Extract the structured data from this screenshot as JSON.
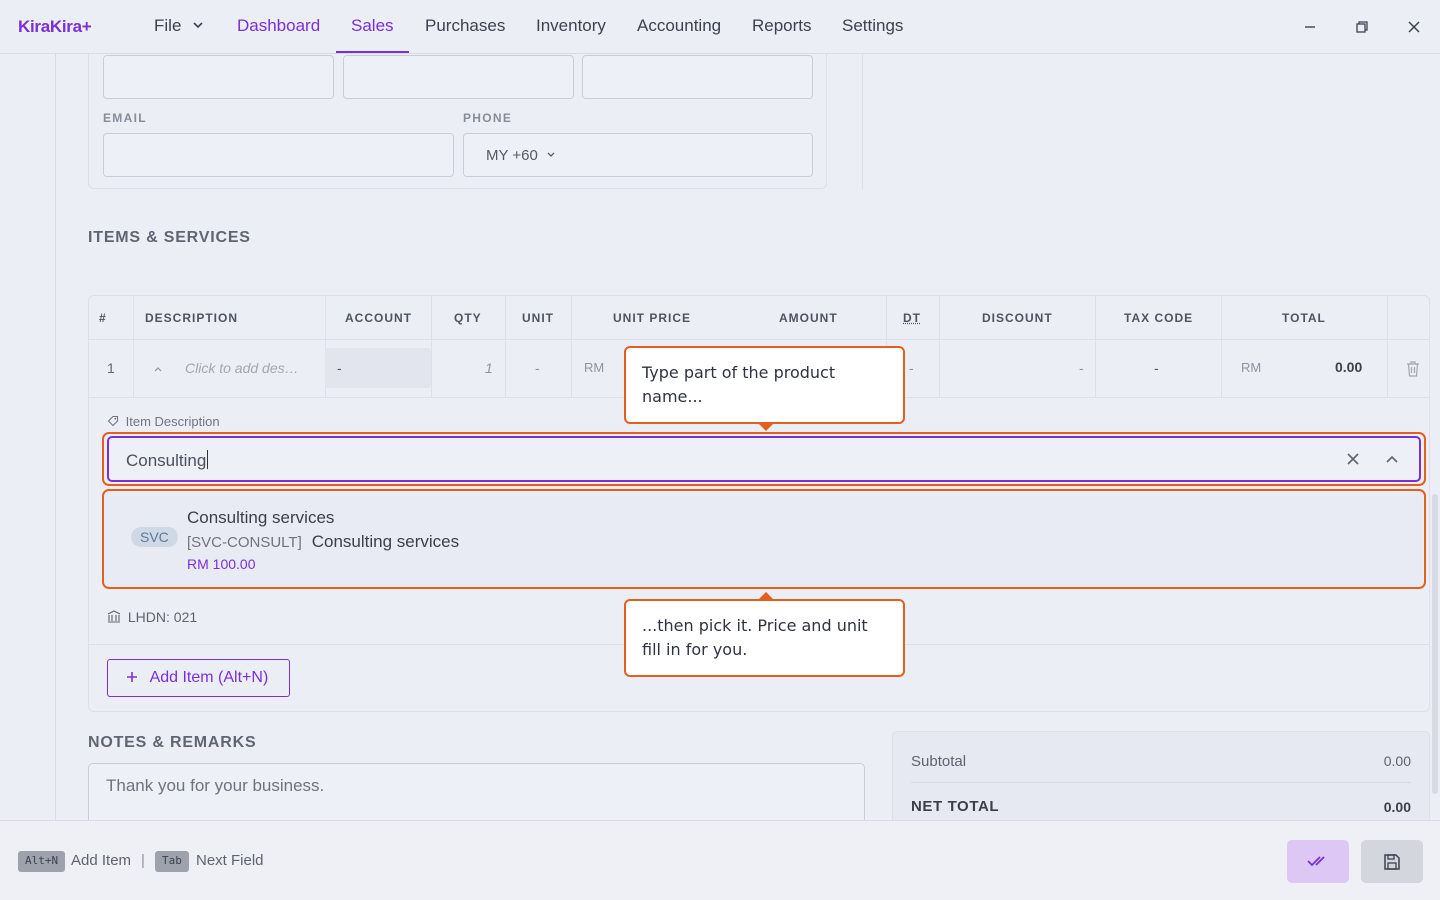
{
  "app": {
    "logo": "KiraKira+"
  },
  "menu": {
    "file": "File",
    "dashboard": "Dashboard",
    "sales": "Sales",
    "purchases": "Purchases",
    "inventory": "Inventory",
    "accounting": "Accounting",
    "reports": "Reports",
    "settings": "Settings"
  },
  "contact": {
    "email_label": "EMAIL",
    "phone_label": "PHONE",
    "phone_country": "MY",
    "phone_code": "+60"
  },
  "items": {
    "section_title": "ITEMS & SERVICES",
    "columns": {
      "num": "#",
      "description": "DESCRIPTION",
      "account": "ACCOUNT",
      "qty": "QTY",
      "unit": "UNIT",
      "unit_price": "UNIT PRICE",
      "amount": "AMOUNT",
      "dt": "DT",
      "discount": "DISCOUNT",
      "tax_code": "TAX CODE",
      "total": "TOTAL"
    },
    "row": {
      "num": "1",
      "description_placeholder": "Click to add des…",
      "account": "-",
      "qty": "1",
      "unit": "-",
      "currency": "RM",
      "dt": "-",
      "discount": "-",
      "tax_code": "-",
      "total_currency": "RM",
      "total": "0.00"
    },
    "description_label": "Item Description",
    "search_value": "Consulting",
    "option": {
      "badge": "SVC",
      "title": "Consulting services",
      "sku": "[SVC-CONSULT]",
      "name": "Consulting services",
      "price": "RM 100.00"
    },
    "lhdn": "LHDN: 021",
    "add_button": "Add Item (Alt+N)"
  },
  "tooltips": {
    "first": "Type part of the product name...",
    "second": "...then pick it. Price and unit fill in for you."
  },
  "notes": {
    "section_title": "NOTES & REMARKS",
    "value": "Thank you for your business."
  },
  "totals": {
    "subtotal_label": "Subtotal",
    "subtotal": "0.00",
    "net_total_label": "NET TOTAL",
    "net_total": "0.00"
  },
  "footer": {
    "key1": "Alt+N",
    "hint1": "Add Item",
    "separator": "|",
    "key2": "Tab",
    "hint2": "Next Field"
  },
  "colors": {
    "accent": "#7b2fd6",
    "highlight": "#e2601c"
  }
}
